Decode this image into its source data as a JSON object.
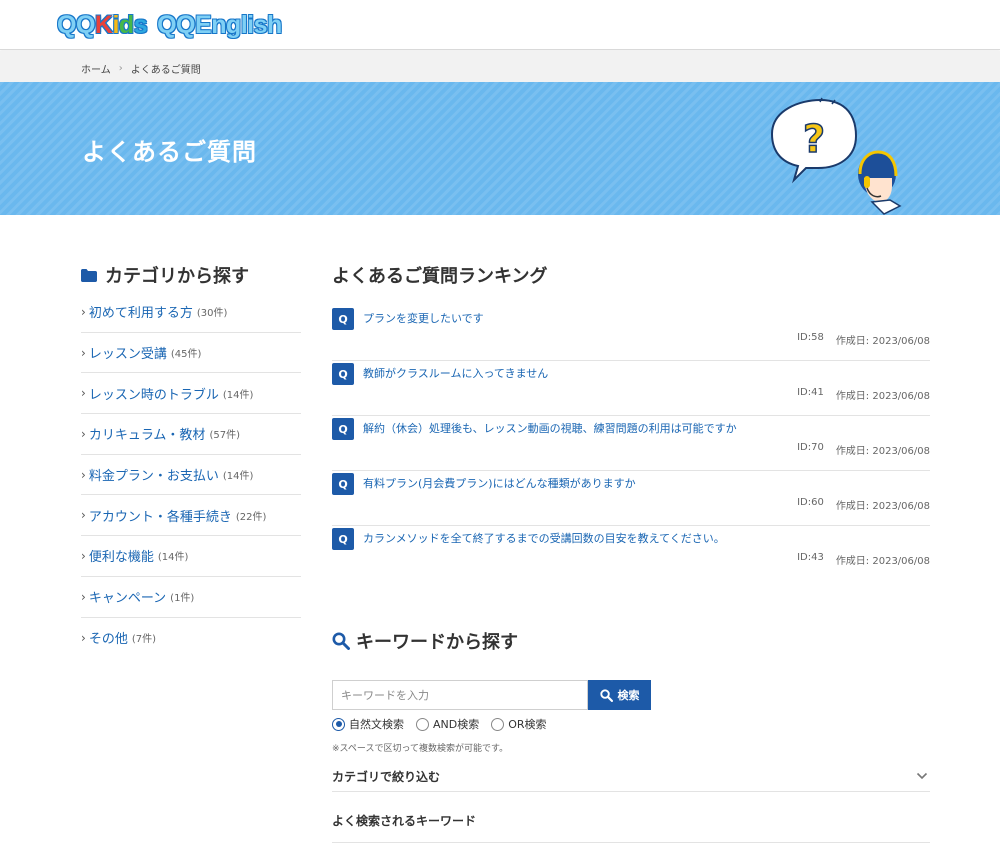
{
  "header": {
    "logo": {
      "qq1": "QQ",
      "kids_k": "K",
      "kids_i": "i",
      "kids_d": "d",
      "kids_s": "s",
      "qq2": "QQ",
      "english": "English"
    }
  },
  "breadcrumb": {
    "home": "ホーム",
    "separator": "›",
    "current": "よくあるご質問"
  },
  "hero": {
    "title": "よくあるご質問",
    "bubble_mark": "?"
  },
  "sidebar": {
    "title": "カテゴリから探す",
    "chevron": "›",
    "items": [
      {
        "label": "初めて利用する方",
        "count": "(30件)"
      },
      {
        "label": "レッスン受講",
        "count": "(45件)"
      },
      {
        "label": "レッスン時のトラブル",
        "count": "(14件)"
      },
      {
        "label": "カリキュラム・教材",
        "count": "(57件)"
      },
      {
        "label": "料金プラン・お支払い",
        "count": "(14件)"
      },
      {
        "label": "アカウント・各種手続き",
        "count": "(22件)"
      },
      {
        "label": "便利な機能",
        "count": "(14件)"
      },
      {
        "label": "キャンペーン",
        "count": "(1件)"
      },
      {
        "label": "その他",
        "count": "(7件)"
      }
    ]
  },
  "ranking": {
    "title": "よくあるご質問ランキング",
    "badge": "Q",
    "items": [
      {
        "question": "プランを変更したいです",
        "id": "ID:58",
        "date": "作成日: 2023/06/08"
      },
      {
        "question": "教師がクラスルームに入ってきません",
        "id": "ID:41",
        "date": "作成日: 2023/06/08"
      },
      {
        "question": "解約（休会）処理後も、レッスン動画の視聴、練習問題の利用は可能ですか",
        "id": "ID:70",
        "date": "作成日: 2023/06/08"
      },
      {
        "question": "有料プラン(月会費プラン)にはどんな種類がありますか",
        "id": "ID:60",
        "date": "作成日: 2023/06/08"
      },
      {
        "question": "カランメソッドを全て終了するまでの受講回数の目安を教えてください。",
        "id": "ID:43",
        "date": "作成日: 2023/06/08"
      }
    ]
  },
  "keyword": {
    "title": "キーワードから探す",
    "placeholder": "キーワードを入力",
    "value": "",
    "search_label": "検索",
    "radios": [
      {
        "label": "自然文検索",
        "checked": true
      },
      {
        "label": "AND検索",
        "checked": false
      },
      {
        "label": "OR検索",
        "checked": false
      }
    ],
    "note": "※スペースで区切って複数検索が可能です。",
    "filter_label": "カテゴリで絞り込む",
    "popular_label": "よく検索されるキーワード"
  },
  "colors": {
    "primary": "#1d5aa8",
    "link": "#1a66b3",
    "hero_bg": "#6ab8ee"
  }
}
